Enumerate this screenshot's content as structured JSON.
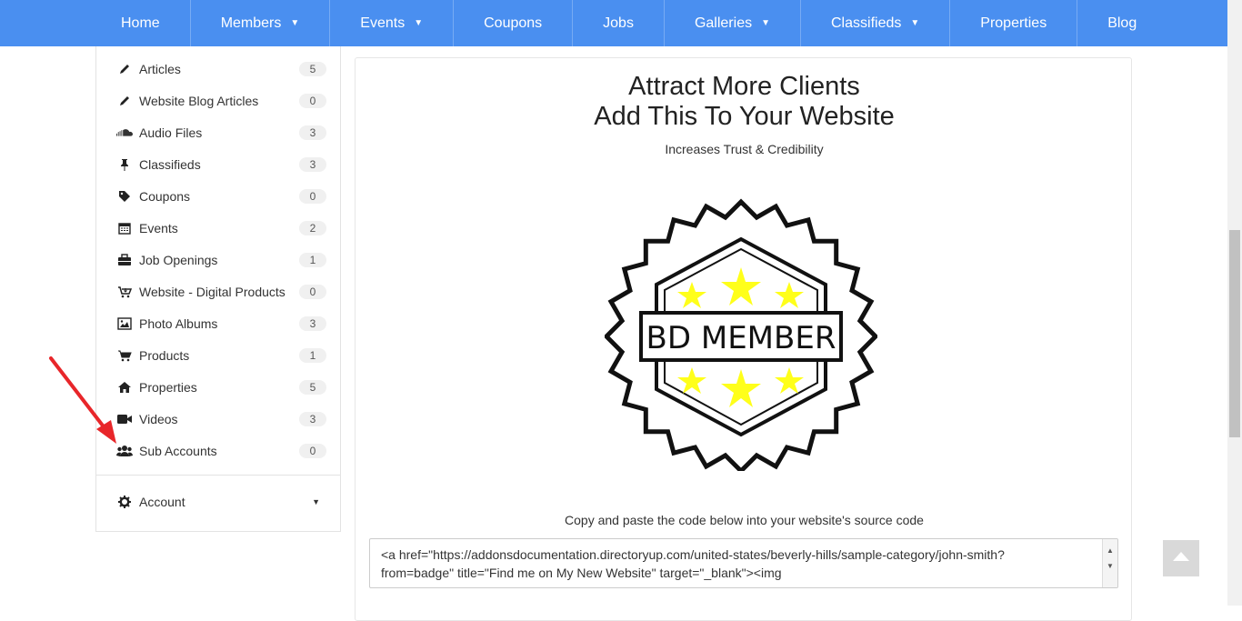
{
  "nav": {
    "items": [
      {
        "label": "Home",
        "dropdown": false
      },
      {
        "label": "Members",
        "dropdown": true
      },
      {
        "label": "Events",
        "dropdown": true
      },
      {
        "label": "Coupons",
        "dropdown": false
      },
      {
        "label": "Jobs",
        "dropdown": false
      },
      {
        "label": "Galleries",
        "dropdown": true
      },
      {
        "label": "Classifieds",
        "dropdown": true
      },
      {
        "label": "Properties",
        "dropdown": false
      },
      {
        "label": "Blog",
        "dropdown": false
      }
    ],
    "caret": "▼"
  },
  "sidebar": {
    "items": [
      {
        "label": "Articles",
        "count": "5",
        "icon": "pencil-icon"
      },
      {
        "label": "Website Blog Articles",
        "count": "0",
        "icon": "pencil-icon"
      },
      {
        "label": "Audio Files",
        "count": "3",
        "icon": "soundcloud-icon"
      },
      {
        "label": "Classifieds",
        "count": "3",
        "icon": "pushpin-icon"
      },
      {
        "label": "Coupons",
        "count": "0",
        "icon": "tag-icon"
      },
      {
        "label": "Events",
        "count": "2",
        "icon": "calendar-icon"
      },
      {
        "label": "Job Openings",
        "count": "1",
        "icon": "briefcase-icon"
      },
      {
        "label": "Website - Digital Products",
        "count": "0",
        "icon": "cart-download-icon"
      },
      {
        "label": "Photo Albums",
        "count": "3",
        "icon": "picture-icon"
      },
      {
        "label": "Products",
        "count": "1",
        "icon": "cart-icon"
      },
      {
        "label": "Properties",
        "count": "5",
        "icon": "home-icon"
      },
      {
        "label": "Videos",
        "count": "3",
        "icon": "video-camera-icon"
      },
      {
        "label": "Sub Accounts",
        "count": "0",
        "icon": "users-icon"
      }
    ],
    "account": {
      "label": "Account",
      "icon": "gear-icon",
      "caret": "▼"
    }
  },
  "main": {
    "title_line1": "Attract More Clients",
    "title_line2": "Add This To Your Website",
    "subtitle": "Increases Trust & Credibility",
    "badge_text": "BD MEMBER",
    "copy_instruction": "Copy and paste the code below into your website's source code",
    "code_line1": "<a href=\"https://addonsdocumentation.directoryup.com/united-states/beverly-hills/sample-category/john-smith?",
    "code_line2": "from=badge\"  title=\"Find me on My New Website\" target=\"_blank\"><img"
  },
  "colors": {
    "nav_bg": "#4a8ff0",
    "star": "#ffff1a",
    "arrow": "#e8262a"
  }
}
